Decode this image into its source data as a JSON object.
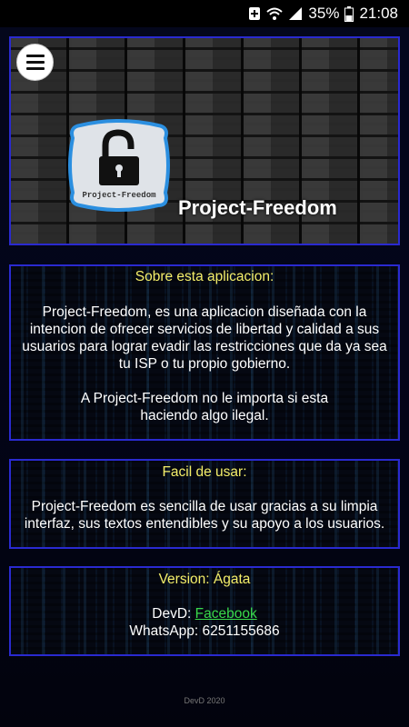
{
  "status_bar": {
    "battery_percent": "35%",
    "time": "21:08"
  },
  "header": {
    "logo_text": "Project-Freedom",
    "title": "Project-Freedom"
  },
  "about": {
    "heading": "Sobre esta aplicacion:",
    "paragraph1": "Project-Freedom, es una aplicacion diseñada con la intencion de ofrecer servicios de libertad y calidad a sus usuarios para lograr evadir las restricciones que da ya sea tu ISP o tu propio gobierno.",
    "paragraph2": "A Project-Freedom no le importa si esta haciendo algo ilegal."
  },
  "easy": {
    "heading": "Facil de usar:",
    "text": "Project-Freedom es sencilla de usar gracias a su limpia interfaz, sus textos entendibles y su apoyo a los usuarios."
  },
  "version": {
    "heading": "Version: Ágata",
    "dev_prefix": "DevD: ",
    "dev_link": "Facebook",
    "whatsapp": "WhatsApp: 6251155686"
  },
  "footer": {
    "text": "DevD 2020"
  },
  "colors": {
    "heading_yellow": "#f4ee6a",
    "link_green": "#39d94b",
    "border_blue": "#2a2ad0"
  }
}
